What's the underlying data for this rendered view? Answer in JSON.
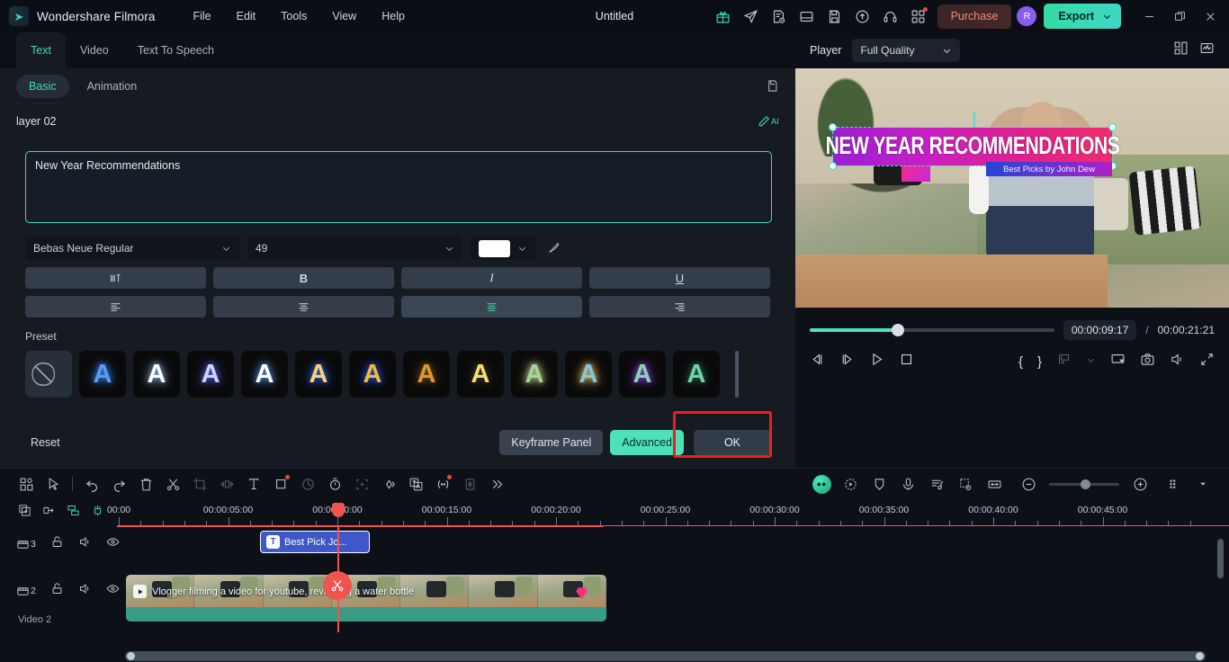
{
  "titlebar": {
    "app_name": "Wondershare Filmora",
    "document_title": "Untitled",
    "menus": [
      "File",
      "Edit",
      "Tools",
      "View",
      "Help"
    ],
    "icons": [
      "gift-icon",
      "send-icon",
      "notes-icon",
      "layout-icon",
      "save-icon",
      "cloud-upload-icon",
      "headset-icon",
      "apps-grid-icon"
    ],
    "purchase_label": "Purchase",
    "avatar_initial": "R",
    "export_label": "Export",
    "accent_color": "#3fdcb6"
  },
  "text_panel": {
    "tabs": [
      {
        "label": "Text",
        "active": true
      },
      {
        "label": "Video",
        "active": false
      },
      {
        "label": "Text To Speech",
        "active": false
      }
    ],
    "subtabs": [
      {
        "label": "Basic",
        "active": true
      },
      {
        "label": "Animation",
        "active": false
      }
    ],
    "layer_name": "layer 02",
    "ai_label": "AI",
    "text_value": "New Year Recommendations",
    "font_family": "Bebas Neue Regular",
    "font_size": "49",
    "font_color": "#ffffff",
    "style_buttons": [
      {
        "name": "spacing",
        "glyph": "spacing-icon",
        "active": false
      },
      {
        "name": "bold",
        "glyph": "B",
        "active": false
      },
      {
        "name": "italic",
        "glyph": "I",
        "active": false
      },
      {
        "name": "underline",
        "glyph": "U",
        "active": false
      },
      {
        "name": "align-left",
        "glyph": "align-left-icon",
        "active": false
      },
      {
        "name": "align-center",
        "glyph": "align-center-icon",
        "active": false
      },
      {
        "name": "align-justify",
        "glyph": "align-justify-icon",
        "active": true
      },
      {
        "name": "align-right",
        "glyph": "align-right-icon",
        "active": false
      }
    ],
    "preset_label": "Preset",
    "presets": [
      {
        "name": "none",
        "letter": "",
        "color": "",
        "glow": ""
      },
      {
        "name": "preset-1",
        "letter": "A",
        "color": "#5b9bf5",
        "glow": "#2f7de0"
      },
      {
        "name": "preset-2",
        "letter": "A",
        "color": "#ffffff",
        "glow": "#7fa8d8"
      },
      {
        "name": "preset-3",
        "letter": "A",
        "color": "#c9d6f7",
        "glow": "#5555d8"
      },
      {
        "name": "preset-4",
        "letter": "A",
        "color": "#ffffff",
        "glow": "#4d8bd6"
      },
      {
        "name": "preset-5",
        "letter": "A",
        "color": "#ffd36b",
        "glow": "#2f5fe0"
      },
      {
        "name": "preset-6",
        "letter": "A",
        "color": "#f5b93a",
        "glow": "#1f4fd8"
      },
      {
        "name": "preset-7",
        "letter": "A",
        "color": "#e2952c",
        "glow": "#6a4a12"
      },
      {
        "name": "preset-8",
        "letter": "A",
        "color": "#f5dd6b",
        "glow": "#3b3620"
      },
      {
        "name": "preset-9",
        "letter": "A",
        "color": "#9fd89a",
        "glow": "#cfcf8e"
      },
      {
        "name": "preset-10",
        "letter": "A",
        "color": "#7fc8e8",
        "glow": "#e8b55a"
      },
      {
        "name": "preset-11",
        "letter": "A",
        "color": "#7fd8a8",
        "glow": "#8d3ad8"
      },
      {
        "name": "preset-12",
        "letter": "A",
        "color": "#6fd3a8",
        "glow": "#2a5c48"
      }
    ],
    "reset_label": "Reset",
    "keyframe_label": "Keyframe Panel",
    "advanced_label": "Advanced",
    "ok_label": "OK",
    "highlight_color": "#f01d1d"
  },
  "player": {
    "label": "Player",
    "quality": "Full Quality",
    "overlay_title": "NEW YEAR RECOMMENDATIONS",
    "overlay_subtitle": "Best Picks by John Dew",
    "current_time": "00:00:09:17",
    "separator": "/",
    "total_time": "00:00:21:21",
    "progress_percent": 36,
    "controls": [
      "prev-frame-icon",
      "next-frame-icon",
      "play-icon",
      "stop-icon",
      "mark-in-icon",
      "mark-out-icon",
      "marker-icon",
      "chevron-down-icon",
      "screen-icon",
      "snapshot-icon",
      "volume-icon",
      "fullscreen-icon"
    ]
  },
  "timeline": {
    "toolbar_left": [
      "media-grid-icon",
      "select-tool-icon",
      "undo-icon",
      "redo-icon",
      "delete-icon",
      "split-icon",
      "crop-icon",
      "speed-icon",
      "text-tool-icon",
      "mask-icon",
      "color-match-icon",
      "stopwatch-icon",
      "motion-track-icon",
      "keyframe-icon",
      "translate-icon",
      "silence-detect-icon",
      "audio-wave-icon",
      "more-icon"
    ],
    "toolbar_right": [
      "ai-tools-icon",
      "ai-portrait-icon",
      "shield-icon",
      "mic-icon",
      "audio-list-icon",
      "green-screen-icon",
      "fit-icon",
      "zoom-out-icon",
      "zoom-slider",
      "zoom-in-icon",
      "grid-view-icon",
      "caret-icon"
    ],
    "zoom_percent": 45,
    "ruler_tools": [
      "add-track-icon",
      "link-icon",
      "markers-icon",
      "magnet-icon"
    ],
    "ruler_labels": [
      "00:00",
      "00:00:05:00",
      "00:00:10:00",
      "00:00:15:00",
      "00:00:20:00",
      "00:00:25:00",
      "00:00:30:00",
      "00:00:35:00",
      "00:00:40:00",
      "00:00:45:00"
    ],
    "tracks": [
      {
        "number": "3",
        "label": "",
        "type": "text"
      },
      {
        "number": "2",
        "label": "Video 2",
        "type": "video"
      }
    ],
    "text_clip_label": "Best Pick     Jo...",
    "text_clip_badge": "T",
    "video_clip_label": "Vlogger filming a video for youtube, reviewing a water bottle",
    "playhead_color": "#f0544f"
  }
}
